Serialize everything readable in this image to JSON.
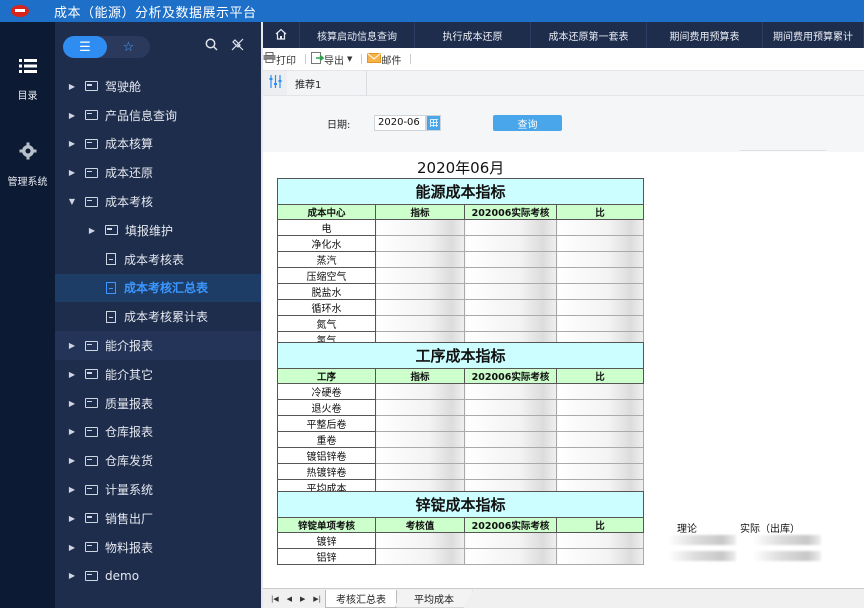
{
  "app": {
    "title": "成本（能源）分析及数据展示平台",
    "logo_icon": "company-logo"
  },
  "rail": {
    "items": [
      {
        "icon": "list-icon",
        "label": "目录"
      },
      {
        "icon": "gear-icon",
        "label": "管理系统"
      }
    ]
  },
  "sidebar": {
    "segment": {
      "list_icon": "list-icon",
      "fav_icon": "star-icon"
    },
    "tools": {
      "search_icon": "search-icon",
      "unpin_icon": "unpin-icon"
    },
    "tree": [
      {
        "label": "驾驶舱",
        "type": "folder",
        "level": 0,
        "expanded": false
      },
      {
        "label": "产品信息查询",
        "type": "folder",
        "level": 0,
        "expanded": false
      },
      {
        "label": "成本核算",
        "type": "folder",
        "level": 0,
        "expanded": false
      },
      {
        "label": "成本还原",
        "type": "folder",
        "level": 0,
        "expanded": false
      },
      {
        "label": "成本考核",
        "type": "folder",
        "level": 0,
        "expanded": true
      },
      {
        "label": "填报维护",
        "type": "folder",
        "level": 1,
        "expanded": false
      },
      {
        "label": "成本考核表",
        "type": "report",
        "level": 1
      },
      {
        "label": "成本考核汇总表",
        "type": "report",
        "level": 1,
        "active": true
      },
      {
        "label": "成本考核累计表",
        "type": "report",
        "level": 1
      },
      {
        "label": "能介报表",
        "type": "folder",
        "level": 0,
        "expanded": false
      },
      {
        "label": "能介其它",
        "type": "folder",
        "level": 0,
        "expanded": false
      },
      {
        "label": "质量报表",
        "type": "folder",
        "level": 0,
        "expanded": false
      },
      {
        "label": "仓库报表",
        "type": "folder",
        "level": 0,
        "expanded": false
      },
      {
        "label": "仓库发货",
        "type": "folder",
        "level": 0,
        "expanded": false
      },
      {
        "label": "计量系统",
        "type": "folder",
        "level": 0,
        "expanded": false
      },
      {
        "label": "销售出厂",
        "type": "folder",
        "level": 0,
        "expanded": false
      },
      {
        "label": "物料报表",
        "type": "folder",
        "level": 0,
        "expanded": false
      },
      {
        "label": "demo",
        "type": "folder",
        "level": 0,
        "expanded": false
      }
    ]
  },
  "tabs": {
    "home_icon": "home-icon",
    "items": [
      "核算启动信息查询",
      "执行成本还原",
      "成本还原第一套表",
      "期间费用预算表",
      "期间费用预算累计"
    ]
  },
  "toolbar": {
    "print": "打印",
    "export": "导出",
    "mail": "邮件"
  },
  "subtabs": {
    "filter_icon": "filter-sliders-icon",
    "items": [
      "推荐1"
    ]
  },
  "params": {
    "date_label": "日期:",
    "date_value": "2020-06",
    "query_button": "查询"
  },
  "report": {
    "title": "2020年06月",
    "sections": [
      {
        "title": "能源成本指标",
        "headers": [
          "成本中心",
          "指标",
          "202006实际考核",
          "比"
        ],
        "rows": [
          "电",
          "净化水",
          "蒸汽",
          "压缩空气",
          "脱盐水",
          "循环水",
          "氮气",
          "氢气"
        ]
      },
      {
        "title": "工序成本指标",
        "headers": [
          "工序",
          "指标",
          "202006实际考核",
          "比"
        ],
        "rows": [
          "冷硬卷",
          "退火卷",
          "平整后卷",
          "重卷",
          "镀铝锌卷",
          "热镀锌卷",
          "平均成本"
        ]
      },
      {
        "title": "锌锭成本指标",
        "headers": [
          "锌锭单项考核",
          "考核值",
          "202006实际考核",
          "比"
        ],
        "rows": [
          "镀锌",
          "铝锌"
        ]
      }
    ],
    "side_labels": {
      "theory": "理论",
      "actual": "实际（出库）"
    }
  },
  "sheets": {
    "nav": [
      "first-sheet-icon",
      "prev-sheet-icon",
      "next-sheet-icon",
      "last-sheet-icon"
    ],
    "items": [
      {
        "label": "考核汇总表",
        "active": true
      },
      {
        "label": "平均成本",
        "active": false
      }
    ]
  }
}
